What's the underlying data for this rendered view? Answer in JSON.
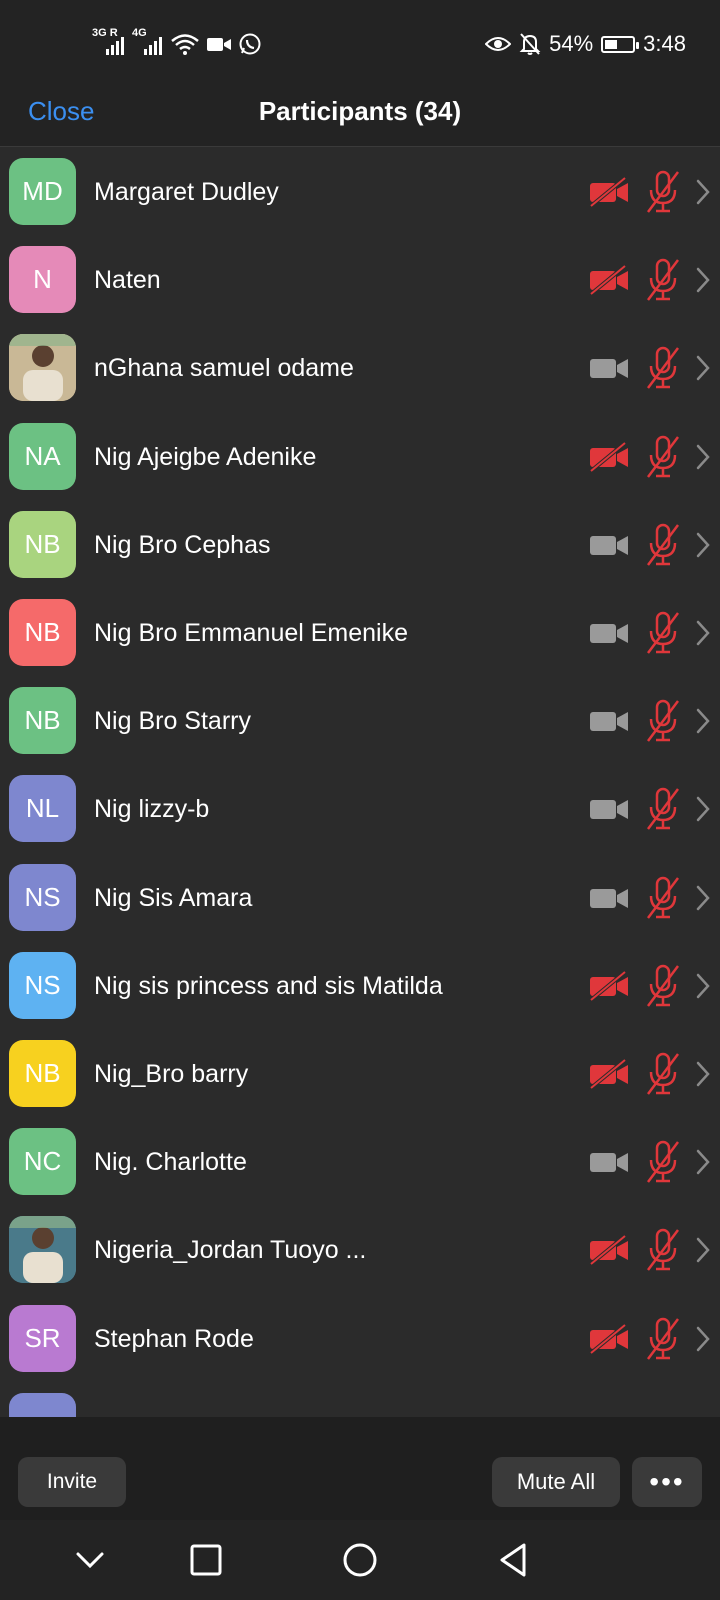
{
  "status_bar": {
    "signal1_tag": "3G R",
    "signal2_tag": "4G",
    "battery_percent": "54%",
    "battery_level": 0.54,
    "time": "3:48"
  },
  "header": {
    "close_label": "Close",
    "title": "Participants (34)"
  },
  "participants": [
    {
      "initials": "MD",
      "name": "Margaret Dudley",
      "avatar_color": "#6cc183",
      "photo": false,
      "video_off": true
    },
    {
      "initials": "N",
      "name": "Naten",
      "avatar_color": "#e58ab8",
      "photo": false,
      "video_off": true
    },
    {
      "initials": "",
      "name": "nGhana samuel odame",
      "avatar_color": "#c9b896",
      "photo": true,
      "video_off": false
    },
    {
      "initials": "NA",
      "name": "Nig Ajeigbe Adenike",
      "avatar_color": "#6cc183",
      "photo": false,
      "video_off": true
    },
    {
      "initials": "NB",
      "name": "Nig Bro Cephas",
      "avatar_color": "#a9d47f",
      "photo": false,
      "video_off": false
    },
    {
      "initials": "NB",
      "name": "Nig Bro Emmanuel Emenike",
      "avatar_color": "#f56a6a",
      "photo": false,
      "video_off": false
    },
    {
      "initials": "NB",
      "name": "Nig Bro Starry",
      "avatar_color": "#6cc183",
      "photo": false,
      "video_off": false
    },
    {
      "initials": "NL",
      "name": "Nig lizzy-b",
      "avatar_color": "#7e87cf",
      "photo": false,
      "video_off": false
    },
    {
      "initials": "NS",
      "name": "Nig Sis Amara",
      "avatar_color": "#7e87cf",
      "photo": false,
      "video_off": false
    },
    {
      "initials": "NS",
      "name": "Nig sis princess and sis Matilda",
      "avatar_color": "#5eb2f2",
      "photo": false,
      "video_off": true
    },
    {
      "initials": "NB",
      "name": "Nig_Bro barry",
      "avatar_color": "#f7d11f",
      "photo": false,
      "video_off": true
    },
    {
      "initials": "NC",
      "name": "Nig. Charlotte",
      "avatar_color": "#6cc183",
      "photo": false,
      "video_off": false
    },
    {
      "initials": "",
      "name": "Nigeria_Jordan Tuoyo ...",
      "avatar_color": "#4a7a8a",
      "photo": true,
      "video_off": true
    },
    {
      "initials": "SR",
      "name": "Stephan Rode",
      "avatar_color": "#b97ad1",
      "photo": false,
      "video_off": true
    }
  ],
  "toolbar": {
    "invite_label": "Invite",
    "mute_all_label": "Mute All",
    "more_label": "•••"
  },
  "colors": {
    "accent": "#3b8ff0",
    "muted_red": "#e0373b",
    "icon_gray": "#9a9a9a"
  }
}
